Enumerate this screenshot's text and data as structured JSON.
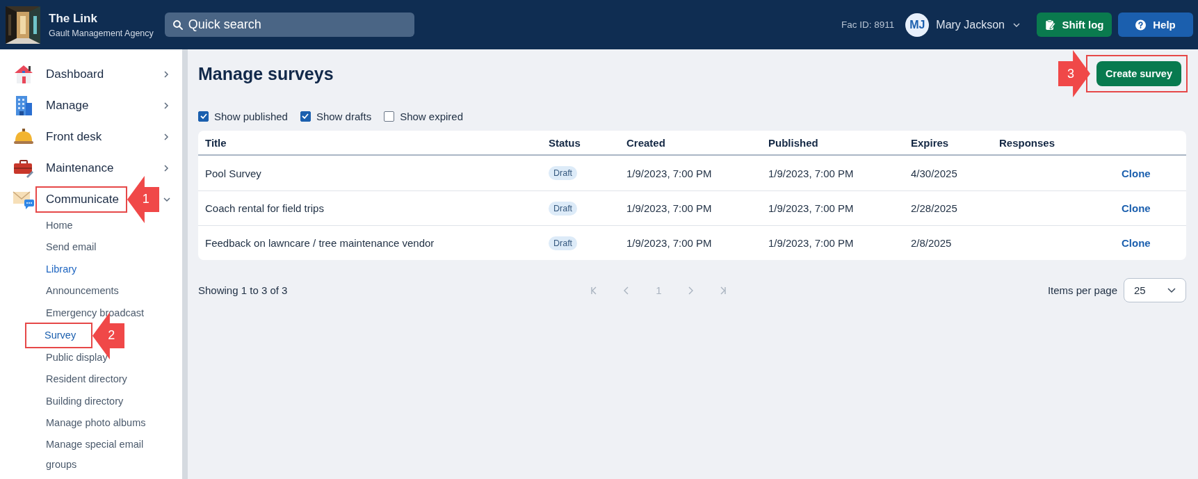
{
  "header": {
    "brand": {
      "title": "The Link",
      "subtitle": "Gault Management Agency"
    },
    "search": {
      "placeholder": "Quick search"
    },
    "fac_id": "Fac ID: 8911",
    "user": {
      "initials": "MJ",
      "name": "Mary Jackson"
    },
    "buttons": [
      {
        "kind": "shift",
        "label": "Shift log"
      },
      {
        "kind": "help",
        "label": "Help"
      }
    ]
  },
  "sidebar": {
    "items": [
      {
        "label": "Dashboard",
        "expanded": false
      },
      {
        "label": "Manage",
        "expanded": false
      },
      {
        "label": "Front desk",
        "expanded": false
      },
      {
        "label": "Maintenance",
        "expanded": false
      },
      {
        "label": "Communicate",
        "expanded": true,
        "callout": "1",
        "children": [
          {
            "label": "Home",
            "selected": false,
            "hovered": false
          },
          {
            "label": "Send email",
            "selected": false,
            "hovered": false
          },
          {
            "label": "Library",
            "selected": false,
            "hovered": true
          },
          {
            "label": "Announcements",
            "selected": false,
            "hovered": false
          },
          {
            "label": "Emergency broadcast",
            "selected": false,
            "hovered": false
          },
          {
            "label": "Survey",
            "selected": true,
            "hovered": false,
            "callout": "2"
          },
          {
            "label": "Public display",
            "selected": false,
            "hovered": false
          },
          {
            "label": "Resident directory",
            "selected": false,
            "hovered": false
          },
          {
            "label": "Building directory",
            "selected": false,
            "hovered": false
          },
          {
            "label": "Manage photo albums",
            "selected": false,
            "hovered": false
          },
          {
            "label": "Manage special email groups",
            "selected": false,
            "hovered": false
          }
        ]
      }
    ]
  },
  "page": {
    "title": "Manage surveys",
    "create_button": {
      "label": "Create survey",
      "callout": "3"
    },
    "filters": [
      {
        "label": "Show published",
        "checked": true
      },
      {
        "label": "Show drafts",
        "checked": true
      },
      {
        "label": "Show expired",
        "checked": false
      }
    ],
    "table": {
      "columns": [
        "Title",
        "Status",
        "Created",
        "Published",
        "Expires",
        "Responses"
      ],
      "rows": [
        {
          "title": "Pool Survey",
          "status": "Draft",
          "created": "1/9/2023, 7:00 PM",
          "published": "1/9/2023, 7:00 PM",
          "expires": "4/30/2025",
          "action": "Clone"
        },
        {
          "title": "Coach rental for field trips",
          "status": "Draft",
          "created": "1/9/2023, 7:00 PM",
          "published": "1/9/2023, 7:00 PM",
          "expires": "2/28/2025",
          "action": "Clone"
        },
        {
          "title": "Feedback on lawncare / tree maintenance vendor",
          "status": "Draft",
          "created": "1/9/2023, 7:00 PM",
          "published": "1/9/2023, 7:00 PM",
          "expires": "2/8/2025",
          "action": "Clone"
        }
      ]
    },
    "footer": {
      "showing": "Showing 1 to 3 of 3",
      "pager": [
        {
          "kind": "first",
          "disabled": true
        },
        {
          "kind": "prev",
          "disabled": true
        },
        {
          "kind": "page",
          "label": "1",
          "disabled": true
        },
        {
          "kind": "next",
          "disabled": true
        },
        {
          "kind": "last",
          "disabled": true
        }
      ],
      "items_per_page_label": "Items per page",
      "items_per_page": "25"
    }
  }
}
